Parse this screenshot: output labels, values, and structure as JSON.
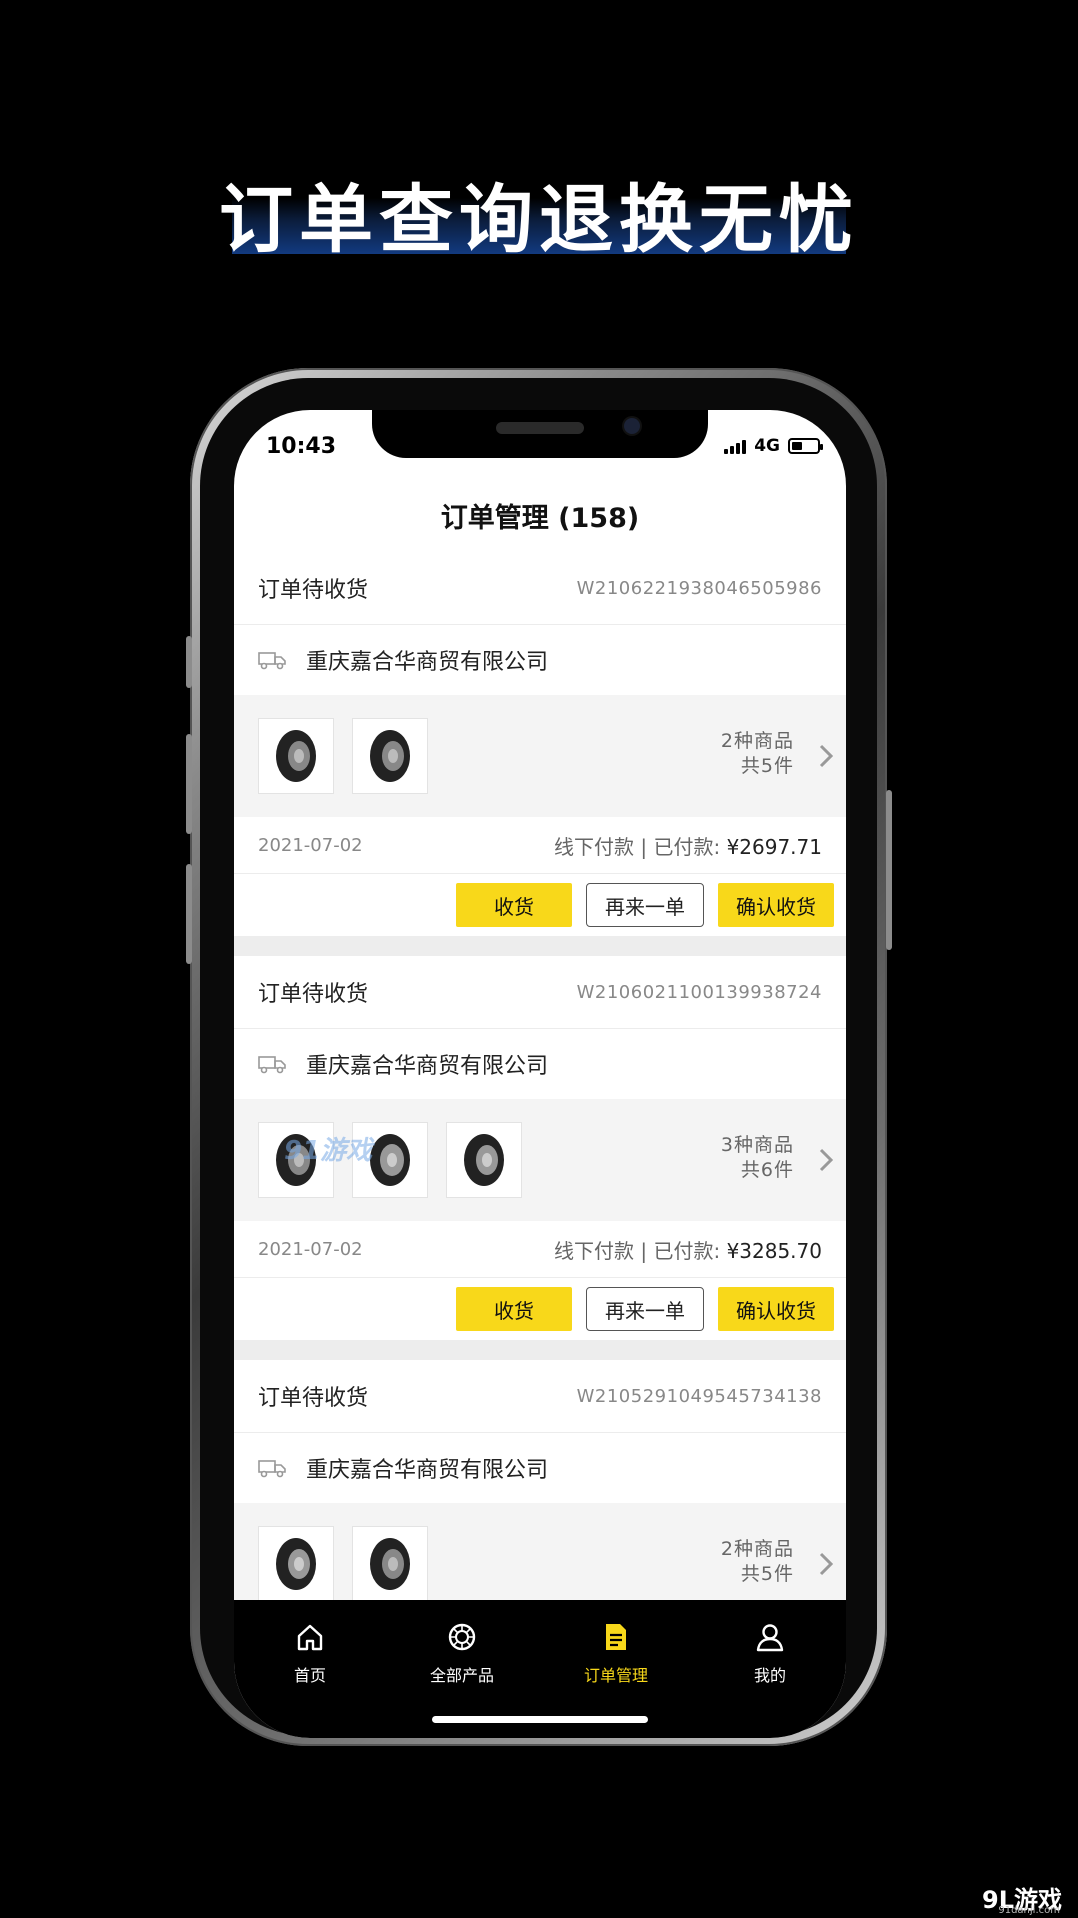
{
  "promo": {
    "headline": "订单查询退换无忧"
  },
  "status_bar": {
    "time": "10:43",
    "network": "4G"
  },
  "header": {
    "title": "订单管理 (158)"
  },
  "orders": [
    {
      "status": "订单待收货",
      "order_no": "W2106221938046505986",
      "shop": "重庆嘉合华商贸有限公司",
      "kinds": "2种商品",
      "count": "共5件",
      "date": "2021-07-02",
      "payment_label": "线下付款 | 已付款:",
      "amount": "¥2697.71",
      "buttons": {
        "receive": "收货",
        "reorder": "再来一单",
        "confirm": "确认收货"
      }
    },
    {
      "status": "订单待收货",
      "order_no": "W2106021100139938724",
      "shop": "重庆嘉合华商贸有限公司",
      "kinds": "3种商品",
      "count": "共6件",
      "date": "2021-07-02",
      "payment_label": "线下付款 | 已付款:",
      "amount": "¥3285.70",
      "buttons": {
        "receive": "收货",
        "reorder": "再来一单",
        "confirm": "确认收货"
      }
    },
    {
      "status": "订单待收货",
      "order_no": "W2105291049545734138",
      "shop": "重庆嘉合华商贸有限公司",
      "kinds": "2种商品",
      "count": "共5件"
    }
  ],
  "watermark": "91游戏",
  "tabbar": {
    "items": [
      {
        "label": "首页",
        "icon": "home-icon"
      },
      {
        "label": "全部产品",
        "icon": "tire-icon"
      },
      {
        "label": "订单管理",
        "icon": "document-icon"
      },
      {
        "label": "我的",
        "icon": "user-icon"
      }
    ],
    "active": "订单管理"
  },
  "corner": {
    "logo": "9L游戏",
    "site": "91danji.com"
  },
  "colors": {
    "accent": "#f8d81a",
    "background": "#000000"
  }
}
